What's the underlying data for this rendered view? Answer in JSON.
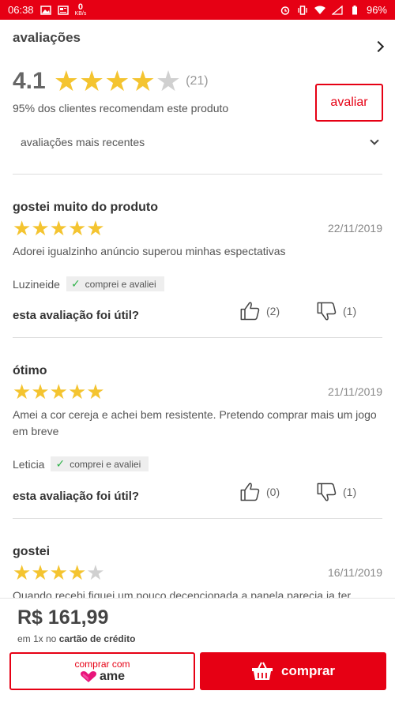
{
  "status_bar": {
    "time": "06:38",
    "net_speed": "0",
    "net_unit": "KB/s",
    "battery": "96%"
  },
  "reviews_section": {
    "title": "avaliações",
    "average": "4.1",
    "average_stars": 4,
    "count": "(21)",
    "recommend_text": "95% dos clientes recomendam este produto",
    "rate_button": "avaliar",
    "sort_label": "avaliações mais recentes"
  },
  "reviews": [
    {
      "title": "gostei muito do produto",
      "stars": 5,
      "date": "22/11/2019",
      "body": "Adorei igualzinho anúncio superou minhas espectativas",
      "author": "Luzineide",
      "verified": "comprei e avaliei",
      "useful_label": "esta avaliação foi útil?",
      "likes": "(2)",
      "dislikes": "(1)"
    },
    {
      "title": "ótimo",
      "stars": 5,
      "date": "21/11/2019",
      "body": "Amei a cor cereja e achei bem resistente. Pretendo comprar mais um jogo em breve",
      "author": "Leticia",
      "verified": "comprei e avaliei",
      "useful_label": "esta avaliação foi útil?",
      "likes": "(0)",
      "dislikes": "(1)"
    },
    {
      "title": "gostei",
      "stars": 4,
      "date": "16/11/2019",
      "body": "Quando recebi fiquei um pouco decepcionada a panela parecia ja ter"
    }
  ],
  "footer": {
    "price": "R$ 161,99",
    "installment_prefix": "em 1x no",
    "installment_method": "cartão de crédito",
    "ame_label": "comprar com",
    "ame_brand": "ame",
    "buy_label": "comprar"
  },
  "colors": {
    "brand": "#e60014",
    "star": "#f4c430",
    "star_off": "#d0d0d0",
    "verified_check": "#2fb34a"
  }
}
